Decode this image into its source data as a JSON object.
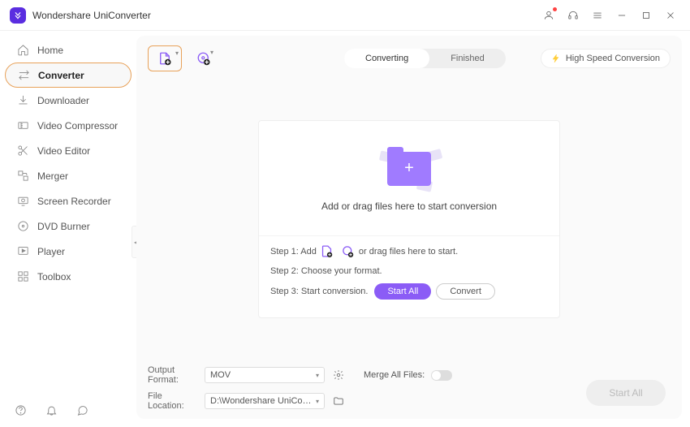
{
  "app": {
    "title": "Wondershare UniConverter"
  },
  "sidebar": {
    "items": [
      {
        "label": "Home"
      },
      {
        "label": "Converter"
      },
      {
        "label": "Downloader"
      },
      {
        "label": "Video Compressor"
      },
      {
        "label": "Video Editor"
      },
      {
        "label": "Merger"
      },
      {
        "label": "Screen Recorder"
      },
      {
        "label": "DVD Burner"
      },
      {
        "label": "Player"
      },
      {
        "label": "Toolbox"
      }
    ]
  },
  "toolbar": {
    "tabs": {
      "converting": "Converting",
      "finished": "Finished"
    },
    "hsc": "High Speed Conversion"
  },
  "drop": {
    "text": "Add or drag files here to start conversion",
    "step1a": "Step 1: Add",
    "step1b": "or drag files here to start.",
    "step2": "Step 2: Choose your format.",
    "step3": "Step 3: Start conversion.",
    "startAll": "Start All",
    "convert": "Convert"
  },
  "footer": {
    "outputFormatLabel": "Output Format:",
    "outputFormat": "MOV",
    "fileLocationLabel": "File Location:",
    "fileLocation": "D:\\Wondershare UniConverter",
    "mergeLabel": "Merge All Files:",
    "startAll": "Start All"
  }
}
